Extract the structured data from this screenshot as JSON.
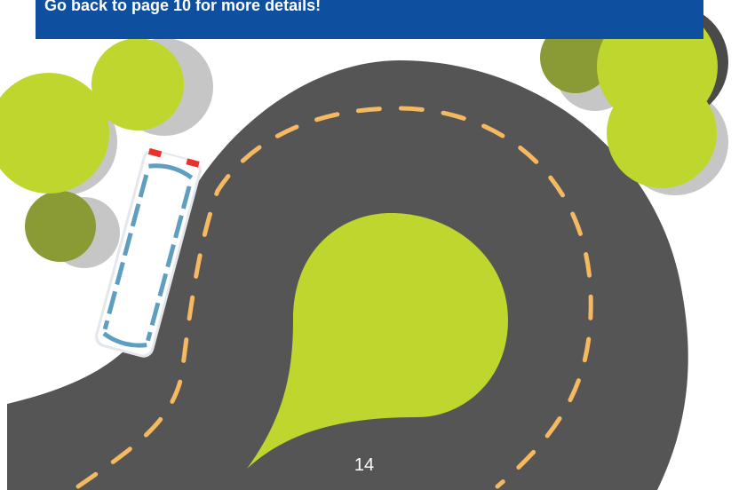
{
  "banner": {
    "text": "Go back to page 10 for more details!"
  },
  "page": {
    "number": "14"
  },
  "colors": {
    "banner_bg": "#0f4fa0",
    "road": "#555555",
    "lane_marking": "#f5b962",
    "island_green": "#bfd62f",
    "tree_light": "#bfd62f",
    "tree_dark": "#8a9a35",
    "tree_shadow": "#c6c6c6",
    "car_body": "#ffffff",
    "car_windows": "#5e9ec0",
    "tail_lights": "#e8322c"
  },
  "icons": [
    "road-icon",
    "bus-icon",
    "tree-icon"
  ]
}
